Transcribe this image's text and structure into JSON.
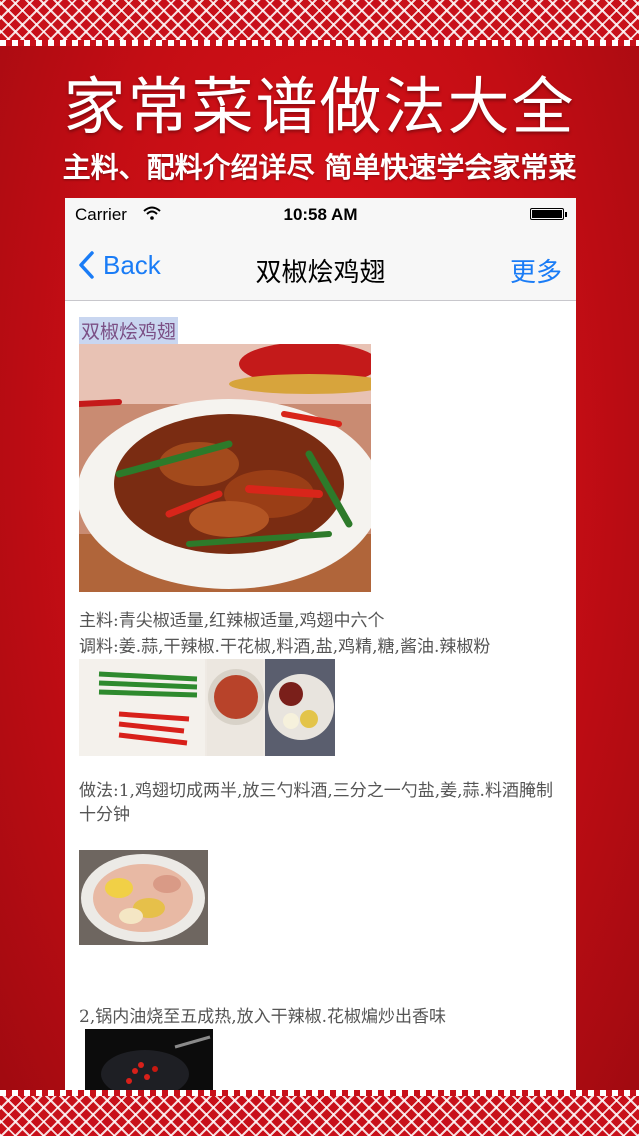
{
  "promo": {
    "title": "家常菜谱做法大全",
    "subtitle": "主料、配料介绍详尽 简单快速学会家常菜"
  },
  "statusbar": {
    "carrier": "Carrier",
    "time": "10:58 AM"
  },
  "navbar": {
    "back_label": "Back",
    "title": "双椒烩鸡翅",
    "more_label": "更多"
  },
  "recipe": {
    "name": "双椒烩鸡翅",
    "main_ingredients": "主料:青尖椒适量,红辣椒适量,鸡翅中六个",
    "seasonings": "调料:姜.蒜,干辣椒.干花椒,料酒,盐,鸡精,糖,酱油.辣椒粉",
    "step1": "做法:1,鸡翅切成两半,放三勺料酒,三分之一勺盐,姜,蒜.料酒腌制十分钟",
    "step2": "2,锅内油烧至五成热,放入干辣椒.花椒煸炒出香味"
  },
  "colors": {
    "accent": "#1a7cf6",
    "background": "#c40d14"
  }
}
